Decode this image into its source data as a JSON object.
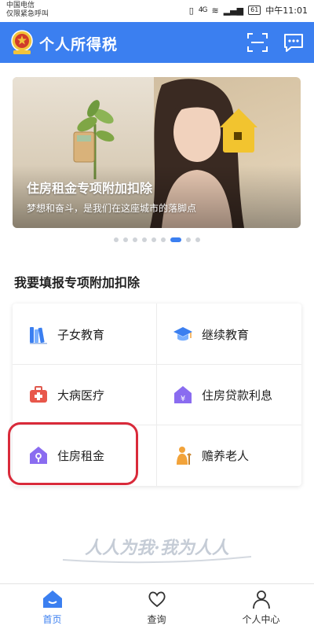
{
  "status_bar": {
    "carrier": "中国电信",
    "emergency": "仅限紧急呼叫",
    "signal": "4G",
    "battery": "61",
    "time": "中午11:01"
  },
  "header": {
    "title": "个人所得税"
  },
  "banner": {
    "title": "住房租金专项附加扣除",
    "subtitle": "梦想和奋斗，是我们在这座城市的落脚点",
    "dot_count": 9,
    "active_dot": 7
  },
  "section": {
    "title": "我要填报专项附加扣除"
  },
  "items": [
    {
      "label": "子女教育",
      "icon": "books-icon"
    },
    {
      "label": "继续教育",
      "icon": "graduation-cap-icon"
    },
    {
      "label": "大病医疗",
      "icon": "medical-kit-icon"
    },
    {
      "label": "住房贷款利息",
      "icon": "house-loan-icon"
    },
    {
      "label": "住房租金",
      "icon": "house-key-icon"
    },
    {
      "label": "赡养老人",
      "icon": "elderly-icon"
    }
  ],
  "slogan": "人人为我·我为人人",
  "nav": {
    "home": "首页",
    "query": "查询",
    "profile": "个人中心"
  },
  "colors": {
    "primary": "#3b7ff0",
    "highlight": "#d92a3a"
  }
}
